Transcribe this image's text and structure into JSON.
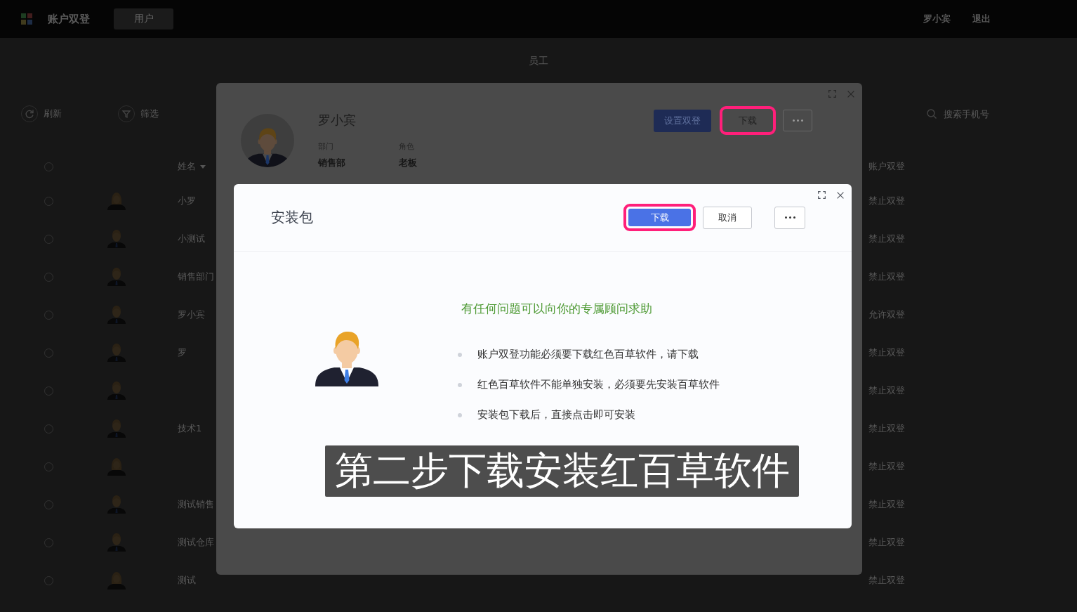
{
  "top_bar": {
    "title": "账户双登",
    "tabs": [
      {
        "label": "用户",
        "selected": true
      }
    ],
    "user_name": "罗小宾",
    "logout": "退出"
  },
  "page": {
    "title": "员工",
    "toolbar": [
      {
        "kind": "refresh",
        "label": "刷新"
      },
      {
        "kind": "filter",
        "label": "筛选"
      }
    ],
    "search": {
      "placeholder": "搜索手机号"
    },
    "table": {
      "select_all": {
        "checked": false
      },
      "columns": [
        {
          "label": "姓名",
          "sorted": true
        },
        {
          "label": "账户双登",
          "sorted": false
        }
      ],
      "rows": [
        {
          "checked": false,
          "kind": "long-hair",
          "name": "小罗",
          "status": "禁止双登"
        },
        {
          "checked": false,
          "kind": "short-hair",
          "name": "小测试",
          "status": "禁止双登"
        },
        {
          "checked": false,
          "kind": "short-hair",
          "name": "销售部门",
          "status": "禁止双登"
        },
        {
          "checked": false,
          "kind": "short-hair",
          "name": "罗小宾",
          "status": "允许双登"
        },
        {
          "checked": false,
          "kind": "short-hair",
          "name": "罗",
          "status": "禁止双登"
        },
        {
          "checked": false,
          "kind": "short-hair",
          "status": "禁止双登"
        },
        {
          "checked": false,
          "kind": "short-hair",
          "name": "技术1",
          "status": "禁止双登"
        },
        {
          "checked": false,
          "kind": "long-hair",
          "status": "禁止双登"
        },
        {
          "checked": false,
          "kind": "short-hair",
          "name": "测试销售",
          "status": "禁止双登"
        },
        {
          "checked": false,
          "kind": "short-hair",
          "name": "测试仓库",
          "status": "禁止双登"
        },
        {
          "checked": false,
          "kind": "long-hair",
          "name": "测试",
          "status": "禁止双登"
        }
      ]
    }
  },
  "profile_modal": {
    "name": "罗小宾",
    "fields": [
      {
        "label": "部门",
        "value": "销售部"
      },
      {
        "label": "角色",
        "value": "老板"
      }
    ],
    "buttons": [
      {
        "kind": "primary",
        "label": "设置双登",
        "highlighted": false
      },
      {
        "kind": "default",
        "label": "下载",
        "highlighted": true
      },
      {
        "kind": "more",
        "highlighted": false
      }
    ]
  },
  "install_dialog": {
    "title": "安装包",
    "buttons": [
      {
        "kind": "primary",
        "label": "下载",
        "highlighted": true
      },
      {
        "kind": "default",
        "label": "取消",
        "highlighted": false
      },
      {
        "kind": "more",
        "highlighted": false
      }
    ],
    "notice": "有任何问题可以向你的专属顾问求助",
    "tips": [
      "账户双登功能必须要下载红色百草软件，请下载",
      "红色百草软件不能单独安装，必须要先安装百草软件",
      "安装包下载后，直接点击即可安装"
    ]
  },
  "caption": {
    "text": "第二步下载安装红百草软件"
  }
}
